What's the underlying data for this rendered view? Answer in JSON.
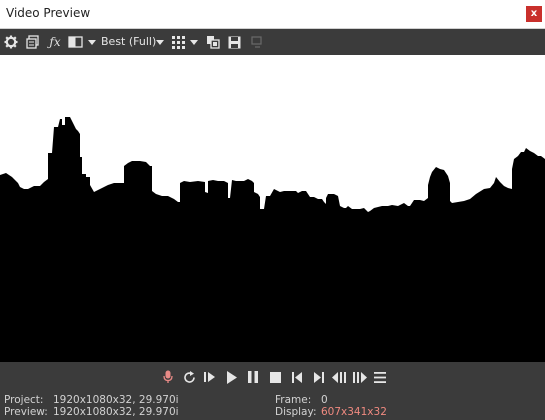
{
  "window": {
    "title": "Video Preview",
    "close_label": "x"
  },
  "toolbar": {
    "quality_label": "Best (Full)",
    "icons": [
      "gear-icon",
      "copy-icon",
      "fx-icon",
      "split-screen-icon",
      "quality-dropdown",
      "grid-icon",
      "copy-snapshot-icon",
      "save-snapshot-icon",
      "external-monitor-icon"
    ]
  },
  "transport": {
    "icons": [
      "record-icon",
      "loop-icon",
      "play-from-start-icon",
      "play-icon",
      "pause-icon",
      "stop-icon",
      "previous-frame-icon",
      "next-frame-icon",
      "step-back-icon",
      "step-forward-icon",
      "menu-icon"
    ]
  },
  "status": {
    "project_label": "Project:",
    "project_value": "1920x1080x32, 29.970i",
    "preview_label": "Preview:",
    "preview_value": "1920x1080x32, 29.970i",
    "frame_label": "Frame:",
    "frame_value": "0",
    "display_label": "Display:",
    "display_value": "607x341x32"
  },
  "colors": {
    "panel": "#3b3b3b",
    "accent_text": "#f08a80",
    "record": "#e88a86",
    "close": "#c9302c"
  }
}
